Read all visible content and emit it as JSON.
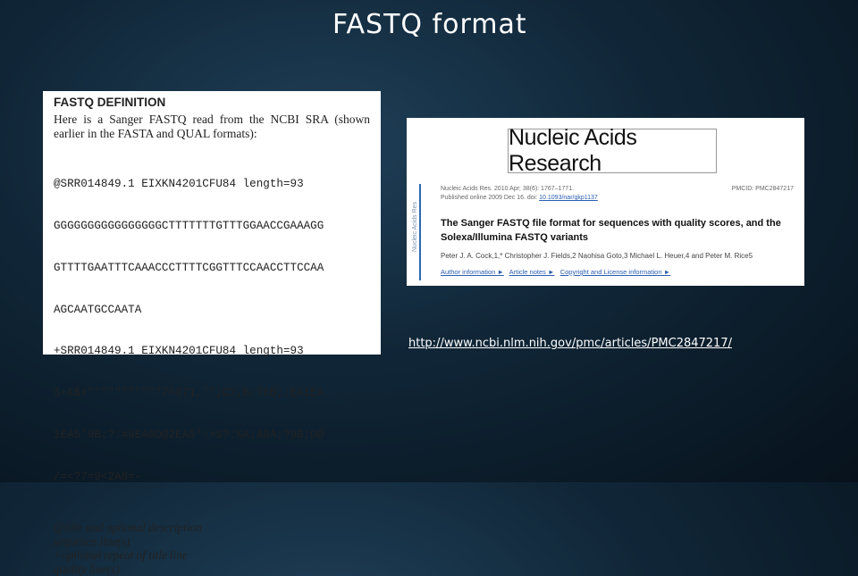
{
  "slide": {
    "title": "FASTQ format"
  },
  "definition": {
    "heading": "FASTQ DEFINITION",
    "intro": "Here is a Sanger FASTQ read from the NCBI SRA (shown earlier in the FASTA and QUAL formats):",
    "code_lines": [
      "@SRR014849.1 EIXKN4201CFU84 length=93",
      "GGGGGGGGGGGGGGGGCTTTTTTTGTTTGGAACCGAAAGG",
      "GTTTTGAATTTCAAACCCTTTTCGGTTTCCAACCTTCCAA",
      "AGCAATGCCAATA",
      "+SRR014849.1 EIXKN4201CFU84 length=93",
      "3+&$#\"\"\"\"\"\"\"\"\"\"\"7F@71,'\";C?,B;?6B;:EA1EA",
      "1EA5'9B:?:#9EA0D@2EA5':>5?:%A;A8A;?9B;D@",
      "/=<?7=9<2A8=-"
    ],
    "legend_lines": [
      "@title and optional description",
      "sequence line(s)",
      "+optional repeat of title line",
      "quality line(s)"
    ]
  },
  "article": {
    "journal_logo": "Nucleic Acids Research",
    "citation": "Nucleic Acids Res. 2010 Apr; 38(6): 1767–1771.",
    "published": "Published online 2009 Dec 16. doi:",
    "doi": "10.1093/nar/gkp1137",
    "pmcid": "PMCID: PMC2847217",
    "side_label": "Nucleic Acids Res",
    "title": "The Sanger FASTQ file format for sequences with quality scores, and the Solexa/Illumina FASTQ variants",
    "authors": "Peter J. A. Cock,1,* Christopher J. Fields,2 Naohisa Goto,3 Michael L. Heuer,4 and Peter M. Rice5",
    "links": [
      "Author information ►",
      "Article notes ►",
      "Copyright and License information ►"
    ]
  },
  "link": {
    "url": "http://www.ncbi.nlm.nih.gov/pmc/articles/PMC2847217/"
  },
  "colors": {
    "background": "#0b1c2b",
    "link_blue": "#2a5db0",
    "accent_bar": "#2a6ab0"
  }
}
